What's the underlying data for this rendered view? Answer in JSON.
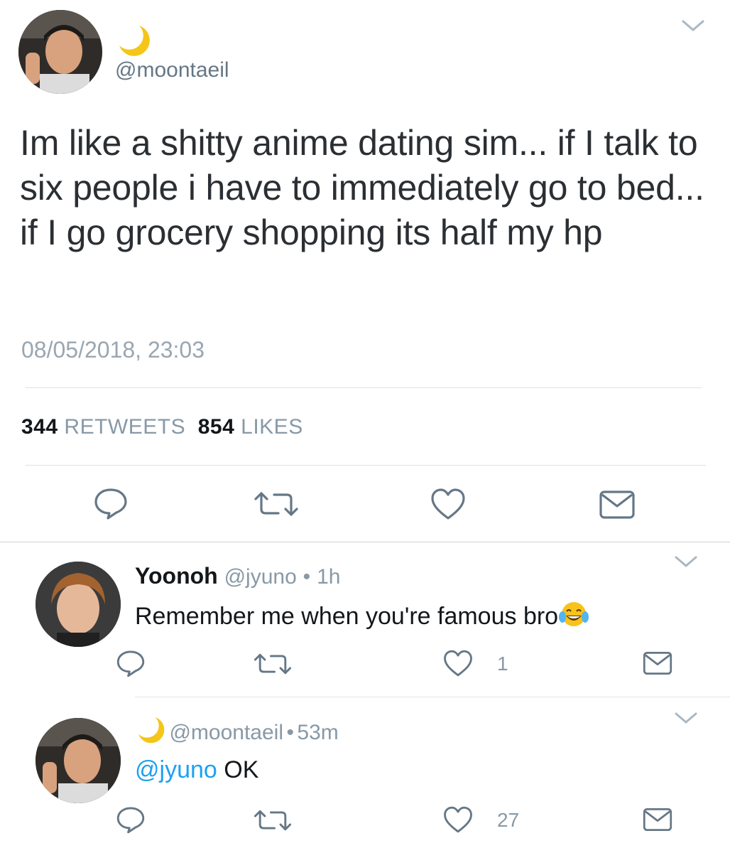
{
  "main_tweet": {
    "author_name_icon": "crescent-moon-emoji",
    "handle": "@moontaeil",
    "text": "Im like a shitty anime dating sim... if I talk to six people i have to immediately go to bed... if I go grocery shopping its half my hp",
    "timestamp": "08/05/2018, 23:03",
    "retweet_count": "344",
    "retweet_label": "RETWEETS",
    "like_count": "854",
    "like_label": "LIKES",
    "actions": [
      "reply-icon",
      "retweet-icon",
      "heart-icon",
      "envelope-icon"
    ]
  },
  "replies": [
    {
      "name": "Yoonoh",
      "handle": "@jyuno",
      "separator": "•",
      "time": "1h",
      "text": "Remember me when you're famous bro",
      "emoji": "face-with-tears-of-joy-emoji",
      "like_count": "1"
    },
    {
      "name_icon": "crescent-moon-emoji",
      "handle": "@moontaeil",
      "separator": "•",
      "time": "53m",
      "mention": "@jyuno",
      "text": "OK",
      "like_count": "27"
    }
  ],
  "colors": {
    "link": "#1da1f2",
    "secondary_text": "#8899a6",
    "icon": "#657786",
    "moon": "#f5c518"
  }
}
